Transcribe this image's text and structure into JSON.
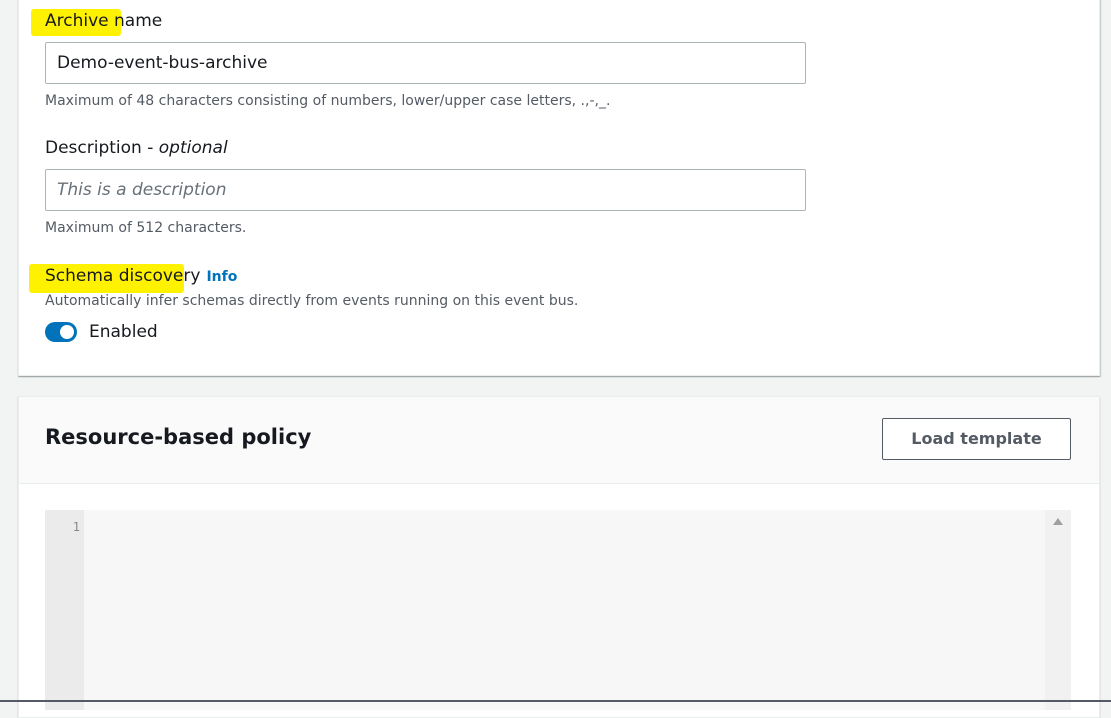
{
  "archive": {
    "label": "Archive name",
    "value": "Demo-event-bus-archive",
    "hint": "Maximum of 48 characters consisting of numbers, lower/upper case letters, .,-,_."
  },
  "description": {
    "label": "Description - ",
    "label_optional": "optional",
    "placeholder": "This is a description",
    "hint": "Maximum of 512 characters."
  },
  "schema": {
    "label": "Schema discovery",
    "info": "Info",
    "hint": "Automatically infer schemas directly from events running on this event bus.",
    "toggle_label": "Enabled",
    "toggle_on": true
  },
  "policy": {
    "title": "Resource-based policy",
    "load_button": "Load template",
    "line_numbers": [
      "1"
    ]
  },
  "colors": {
    "highlight": "#fff200",
    "accent": "#0073bb"
  }
}
